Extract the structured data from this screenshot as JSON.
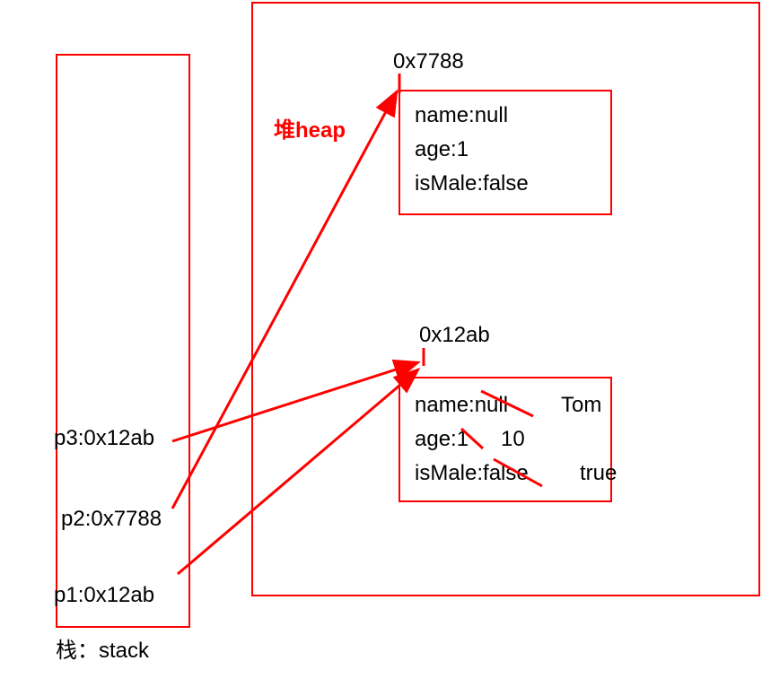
{
  "stack": {
    "label": "栈：stack",
    "p3": "p3:0x12ab",
    "p2": "p2:0x7788",
    "p1": "p1:0x12ab"
  },
  "heap": {
    "label": "堆heap",
    "obj1": {
      "addr": "0x7788",
      "line1": "name:null",
      "line2": "age:1",
      "line3": "isMale:false"
    },
    "obj2": {
      "addr": "0x12ab",
      "line1": "name:null",
      "line2": "age:1",
      "line3": "isMale:false",
      "new_name": "Tom",
      "new_age": "10",
      "new_isMale": "true"
    }
  }
}
